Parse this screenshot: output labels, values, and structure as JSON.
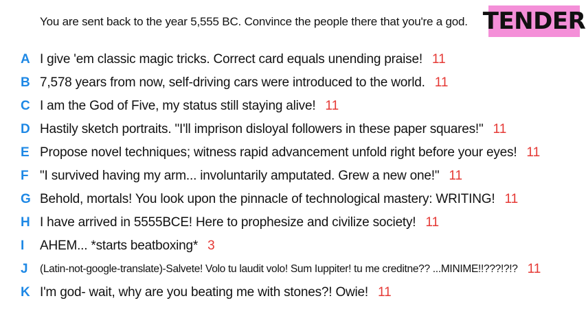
{
  "prompt": "You are sent back to the year 5,555 BC. Convince the people there that you're a god.",
  "badge": {
    "label": "TENDER",
    "color": "#f48fd8"
  },
  "colors": {
    "letter": "#1e88e5",
    "score": "#e53935"
  },
  "answers": [
    {
      "letter": "A",
      "text": "I give 'em classic magic tricks. Correct card equals unending praise!",
      "score": "11"
    },
    {
      "letter": "B",
      "text": "7,578 years from now, self-driving cars were introduced to the world.",
      "score": "11"
    },
    {
      "letter": "C",
      "text": "I am the God of Five, my status still staying alive!",
      "score": "11"
    },
    {
      "letter": "D",
      "text": "Hastily sketch portraits. \"I'll imprison disloyal followers in these paper squares!\"",
      "score": "11"
    },
    {
      "letter": "E",
      "text": "Propose novel techniques; witness rapid advancement unfold right before your eyes!",
      "score": "11"
    },
    {
      "letter": "F",
      "text": "\"I survived having my arm... involuntarily amputated. Grew a new one!\"",
      "score": "11"
    },
    {
      "letter": "G",
      "text": "Behold, mortals! You look upon the pinnacle of technological mastery: WRITING!",
      "score": "11"
    },
    {
      "letter": "H",
      "text": "I have arrived in 5555BCE! Here to prophesize and civilize society!",
      "score": "11"
    },
    {
      "letter": "I",
      "text": "AHEM... *starts beatboxing*",
      "score": "3"
    },
    {
      "letter": "J",
      "text": "(Latin-not-google-translate)-Salvete! Volo tu laudit volo! Sum Iuppiter! tu me creditne?? ...MINIME!!???!?!?",
      "score": "11"
    },
    {
      "letter": "K",
      "text": "I'm god- wait, why are you beating me with stones?! Owie!",
      "score": "11"
    }
  ]
}
